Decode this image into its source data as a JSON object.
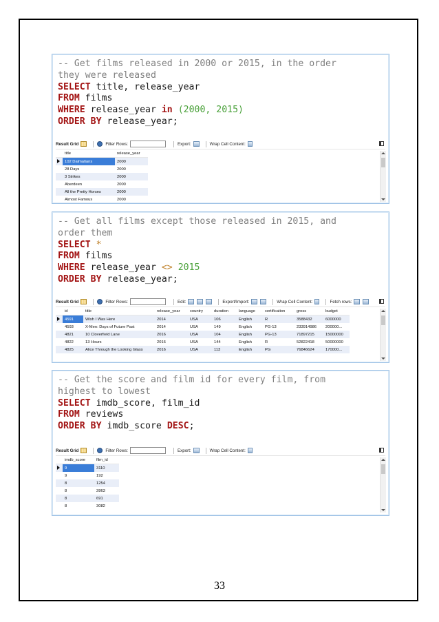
{
  "page_number": "33",
  "blocks": [
    {
      "code_lines": [
        [
          {
            "t": "-- Get films released in 2000 or 2015, in the order",
            "c": "cm"
          }
        ],
        [
          {
            "t": "they were released",
            "c": "cm"
          }
        ],
        [
          {
            "t": "SELECT",
            "c": "kw"
          },
          {
            "t": " title, release_year",
            "c": ""
          }
        ],
        [
          {
            "t": "FROM",
            "c": "kw"
          },
          {
            "t": " films",
            "c": ""
          }
        ],
        [
          {
            "t": "WHERE",
            "c": "kw"
          },
          {
            "t": " release_year ",
            "c": ""
          },
          {
            "t": "in",
            "c": "kw"
          },
          {
            "t": " ",
            "c": ""
          },
          {
            "t": "(2000, 2015)",
            "c": "num"
          }
        ],
        [
          {
            "t": "ORDER BY",
            "c": "kw"
          },
          {
            "t": " release_year;",
            "c": ""
          }
        ]
      ],
      "toolbar": {
        "result_grid": "Result Grid",
        "filter_rows": "Filter Rows:",
        "edit": "",
        "export": "Export:",
        "wrap": "Wrap Cell Content:",
        "fetch": ""
      },
      "columns": [
        "title",
        "release_year"
      ],
      "rows": [
        [
          "102 Dalmatians",
          "2000"
        ],
        [
          "28 Days",
          "2000"
        ],
        [
          "3 Strikes",
          "2000"
        ],
        [
          "Aberdeen",
          "2000"
        ],
        [
          "All the Pretty Horses",
          "2000"
        ],
        [
          "Almost Famous",
          "2000"
        ]
      ]
    },
    {
      "code_lines": [
        [
          {
            "t": "-- Get all films except those released in 2015, and",
            "c": "cm"
          }
        ],
        [
          {
            "t": "order them",
            "c": "cm"
          }
        ],
        [
          {
            "t": "SELECT",
            "c": "kw"
          },
          {
            "t": " ",
            "c": ""
          },
          {
            "t": "*",
            "c": "op"
          }
        ],
        [
          {
            "t": "FROM",
            "c": "kw"
          },
          {
            "t": " films",
            "c": ""
          }
        ],
        [
          {
            "t": "WHERE",
            "c": "kw"
          },
          {
            "t": " release_year ",
            "c": ""
          },
          {
            "t": "<>",
            "c": "op"
          },
          {
            "t": " ",
            "c": ""
          },
          {
            "t": "2015",
            "c": "num"
          }
        ],
        [
          {
            "t": "ORDER BY",
            "c": "kw"
          },
          {
            "t": " release_year;",
            "c": ""
          }
        ]
      ],
      "toolbar": {
        "result_grid": "Result Grid",
        "filter_rows": "Filter Rows:",
        "edit": "Edit:",
        "export": "Export/Import:",
        "wrap": "Wrap Cell Content:",
        "fetch": "Fetch rows:"
      },
      "columns": [
        "id",
        "title",
        "release_year",
        "country",
        "duration",
        "language",
        "certification",
        "gross",
        "budget"
      ],
      "rows": [
        [
          "4591",
          "Wish I Was Here",
          "2014",
          "USA",
          "106",
          "English",
          "R",
          "3588432",
          "6000000"
        ],
        [
          "4593",
          "X-Men: Days of Future Past",
          "2014",
          "USA",
          "149",
          "English",
          "PG-13",
          "233914986",
          "200000..."
        ],
        [
          "4821",
          "10 Cloverfield Lane",
          "2016",
          "USA",
          "104",
          "English",
          "PG-13",
          "71897215",
          "15000000"
        ],
        [
          "4822",
          "13 Hours",
          "2016",
          "USA",
          "144",
          "English",
          "R",
          "52822418",
          "50000000"
        ],
        [
          "4825",
          "Alice Through the Looking Glass",
          "2016",
          "USA",
          "113",
          "English",
          "PG",
          "76846624",
          "170000..."
        ]
      ]
    },
    {
      "code_lines": [
        [
          {
            "t": "-- Get the score and film id for every film, from",
            "c": "cm"
          }
        ],
        [
          {
            "t": "highest to lowest",
            "c": "cm"
          }
        ],
        [
          {
            "t": "SELECT",
            "c": "kw"
          },
          {
            "t": " imdb_score, film_id",
            "c": ""
          }
        ],
        [
          {
            "t": "FROM",
            "c": "kw"
          },
          {
            "t": " reviews",
            "c": ""
          }
        ],
        [
          {
            "t": "ORDER BY",
            "c": "kw"
          },
          {
            "t": " imdb_score ",
            "c": ""
          },
          {
            "t": "DESC",
            "c": "kw"
          },
          {
            "t": ";",
            "c": ""
          }
        ]
      ],
      "toolbar": {
        "result_grid": "Result Grid",
        "filter_rows": "Filter Rows:",
        "edit": "",
        "export": "Export:",
        "wrap": "Wrap Cell Content:",
        "fetch": ""
      },
      "columns": [
        "imdb_score",
        "film_id"
      ],
      "rows": [
        [
          "9",
          "3110"
        ],
        [
          "9",
          "192"
        ],
        [
          "8",
          "1254"
        ],
        [
          "8",
          "2863"
        ],
        [
          "8",
          "691"
        ],
        [
          "8",
          "3082"
        ]
      ]
    }
  ]
}
